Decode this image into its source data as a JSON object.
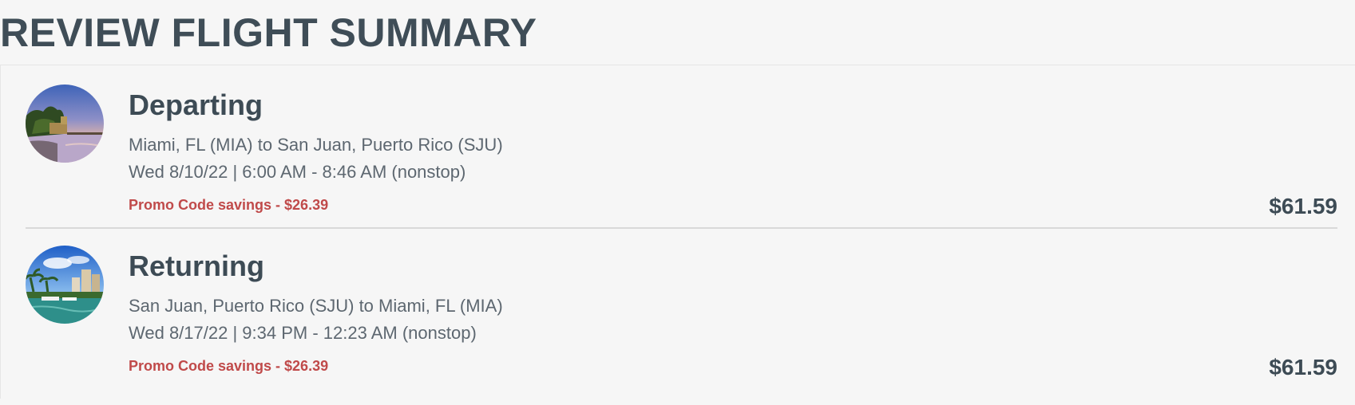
{
  "page": {
    "title": "REVIEW FLIGHT SUMMARY"
  },
  "flights": [
    {
      "leg": "Departing",
      "route": "Miami, FL (MIA) to San Juan, Puerto Rico (SJU)",
      "schedule": "Wed 8/10/22 | 6:00 AM - 8:46 AM (nonstop)",
      "promo": "Promo Code savings - $26.39",
      "price": "$61.59",
      "image_icon": "coastal-fortress-sunset-photo"
    },
    {
      "leg": "Returning",
      "route": "San Juan, Puerto Rico (SJU) to Miami, FL (MIA)",
      "schedule": "Wed 8/17/22 | 9:34 PM - 12:23 AM (nonstop)",
      "promo": "Promo Code savings - $26.39",
      "price": "$61.59",
      "image_icon": "miami-marina-skyline-photo"
    }
  ],
  "colors": {
    "heading": "#3d4b55",
    "body_text": "#5d6770",
    "promo": "#c04a4a",
    "background": "#f6f6f6",
    "divider": "#d9d9d9"
  }
}
